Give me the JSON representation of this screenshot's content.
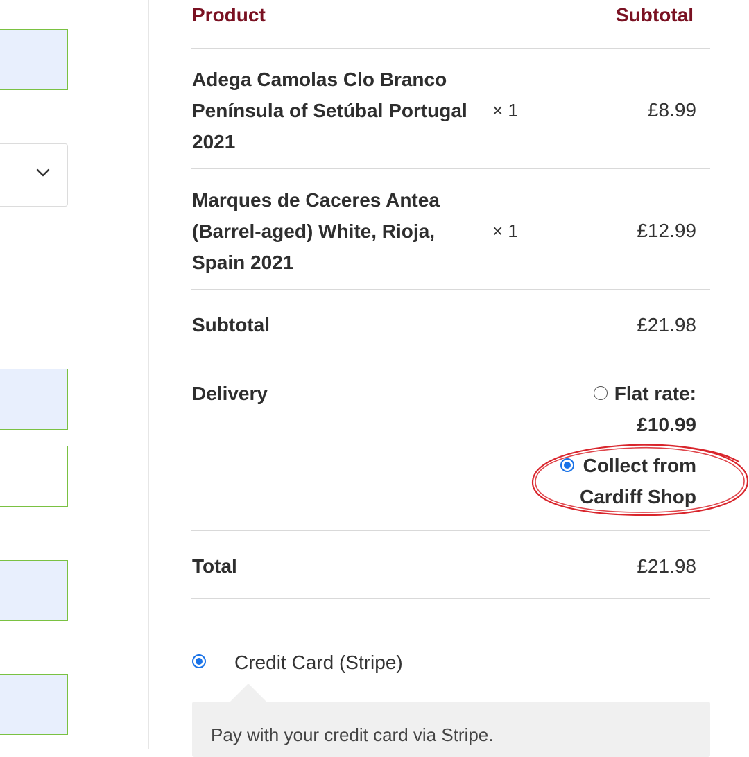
{
  "table": {
    "header_product": "Product",
    "header_subtotal": "Subtotal",
    "items": [
      {
        "name_lines": [
          "Adega Camolas Clo Branco",
          "Península of Setúbal Portugal",
          "2021"
        ],
        "qty": "× 1",
        "price": "£8.99"
      },
      {
        "name_lines": [
          "Marques de Caceres Antea",
          "(Barrel-aged) White, Rioja,",
          "Spain 2021"
        ],
        "qty": "× 1",
        "price": "£12.99"
      }
    ],
    "subtotal_label": "Subtotal",
    "subtotal_value": "£21.98",
    "delivery_label": "Delivery",
    "delivery_options": {
      "flat_rate_label": "Flat rate:",
      "flat_rate_price": "£10.99",
      "collect_line1": "Collect from",
      "collect_line2": "Cardiff Shop",
      "selected": "collect"
    },
    "total_label": "Total",
    "total_value": "£21.98"
  },
  "payment": {
    "method_label": "Credit Card (Stripe)",
    "selected": true,
    "description": "Pay with your credit card via Stripe."
  },
  "colors": {
    "heading": "#7a1122",
    "radio_selected": "#1a73e8",
    "annotation": "#d9252c",
    "field_border": "#7ac142",
    "field_fill": "#e8effd"
  }
}
